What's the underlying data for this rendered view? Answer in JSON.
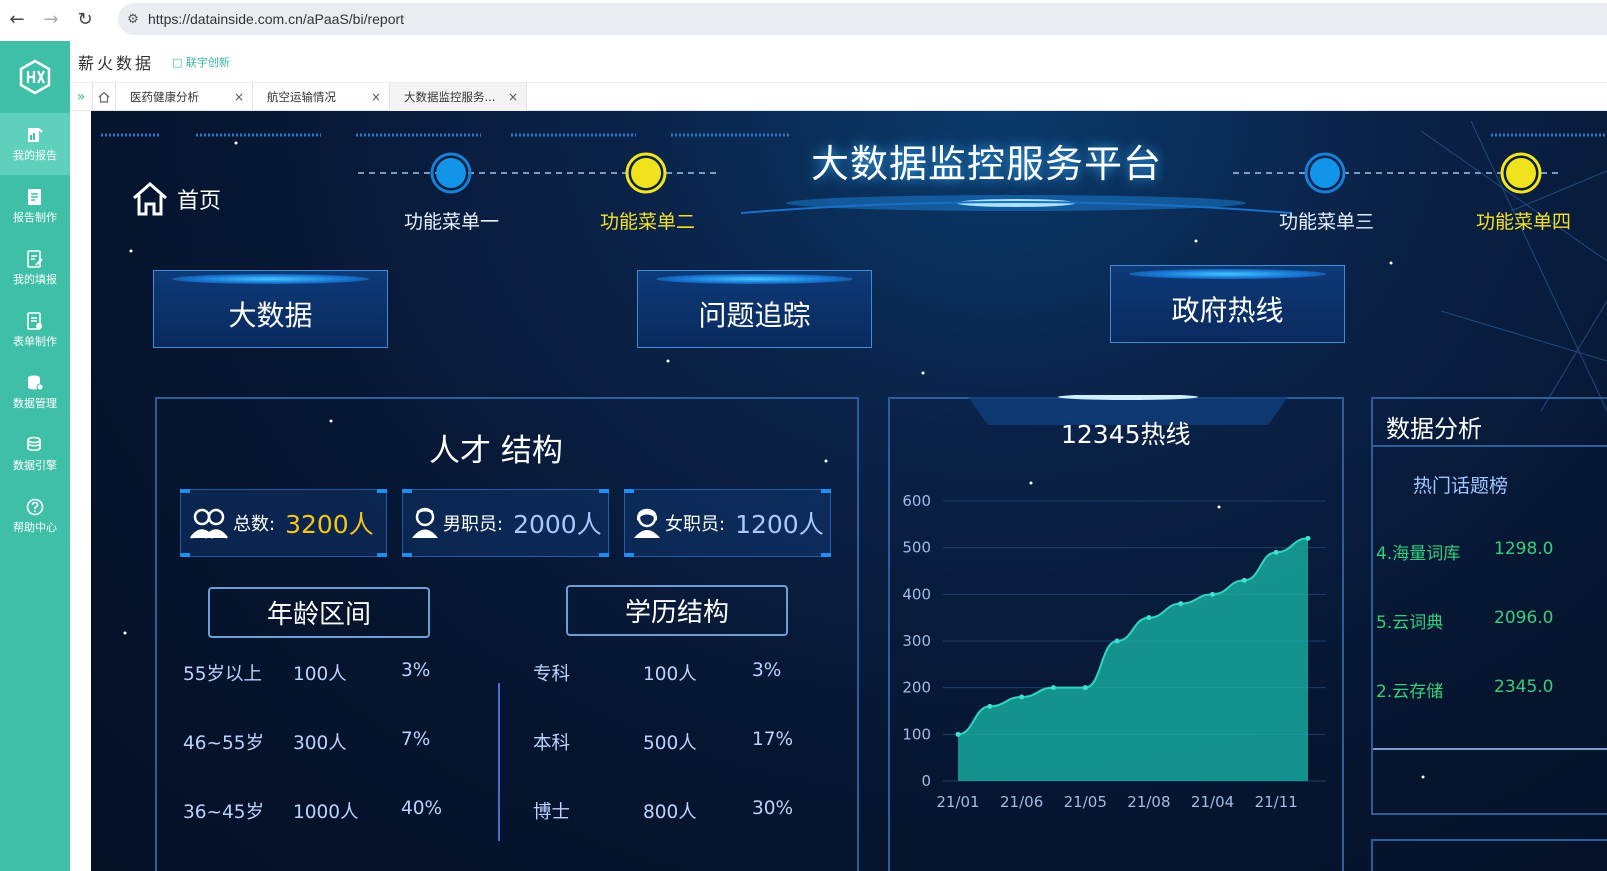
{
  "browser": {
    "url": "https://datainside.com.cn/aPaaS/bi/report"
  },
  "app": {
    "brand": "薪火数据",
    "sub_brand": "联宇创新"
  },
  "sidebar": {
    "items": [
      {
        "label": "我的报告",
        "icon": "report-icon"
      },
      {
        "label": "报告制作",
        "icon": "report-edit-icon"
      },
      {
        "label": "我的填报",
        "icon": "fill-icon"
      },
      {
        "label": "表单制作",
        "icon": "form-icon"
      },
      {
        "label": "数据管理",
        "icon": "database-icon"
      },
      {
        "label": "数据引擎",
        "icon": "engine-icon"
      },
      {
        "label": "帮助中心",
        "icon": "help-icon"
      }
    ]
  },
  "tabs": [
    {
      "label": "医药健康分析"
    },
    {
      "label": "航空运输情况"
    },
    {
      "label": "大数据监控服务..."
    }
  ],
  "dashboard": {
    "title": "大数据监控服务平台",
    "home": "首页",
    "menus": [
      "功能菜单一",
      "功能菜单二",
      "功能菜单三",
      "功能菜单四"
    ],
    "buttons": [
      "大数据",
      "问题追踪",
      "政府热线"
    ],
    "talent": {
      "title": "人才 结构",
      "stats": [
        {
          "label": "总数:",
          "value": "3200人",
          "color": "#f5c51a"
        },
        {
          "label": "男职员:",
          "value": "2000人",
          "color": "#a9c8ff"
        },
        {
          "label": "女职员:",
          "value": "1200人",
          "color": "#a9c8ff"
        }
      ],
      "age_title": "年龄区间",
      "edu_title": "学历结构",
      "age_rows": [
        {
          "range": "55岁以上",
          "count": "100人",
          "pct": "3%"
        },
        {
          "range": "46~55岁",
          "count": "300人",
          "pct": "7%"
        },
        {
          "range": "36~45岁",
          "count": "1000人",
          "pct": "40%"
        }
      ],
      "edu_rows": [
        {
          "level": "专科",
          "count": "100人",
          "pct": "3%"
        },
        {
          "level": "本科",
          "count": "500人",
          "pct": "17%"
        },
        {
          "level": "博士",
          "count": "800人",
          "pct": "30%"
        }
      ]
    },
    "analysis": {
      "title": "数据分析",
      "topic_title": "热门话题榜",
      "topics": [
        {
          "name": "4.海量词库",
          "value": "1298.0"
        },
        {
          "name": "5.云词典",
          "value": "2096.0"
        },
        {
          "name": "2.云存储",
          "value": "2345.0"
        }
      ]
    }
  },
  "chart_data": {
    "type": "area",
    "title": "12345热线",
    "x": [
      "21/01",
      "",
      "21/06",
      "",
      "21/05",
      "",
      "21/08",
      "",
      "21/04",
      "",
      "21/11",
      ""
    ],
    "x_tick_labels": [
      "21/01",
      "21/06",
      "21/05",
      "21/08",
      "21/04",
      "21/11"
    ],
    "values": [
      100,
      160,
      180,
      200,
      200,
      300,
      350,
      380,
      400,
      430,
      490,
      520
    ],
    "ylim": [
      0,
      600
    ],
    "yticks": [
      "0",
      "100",
      "200",
      "300",
      "400",
      "500",
      "600"
    ],
    "color": "#18b5a6",
    "grid": true
  }
}
